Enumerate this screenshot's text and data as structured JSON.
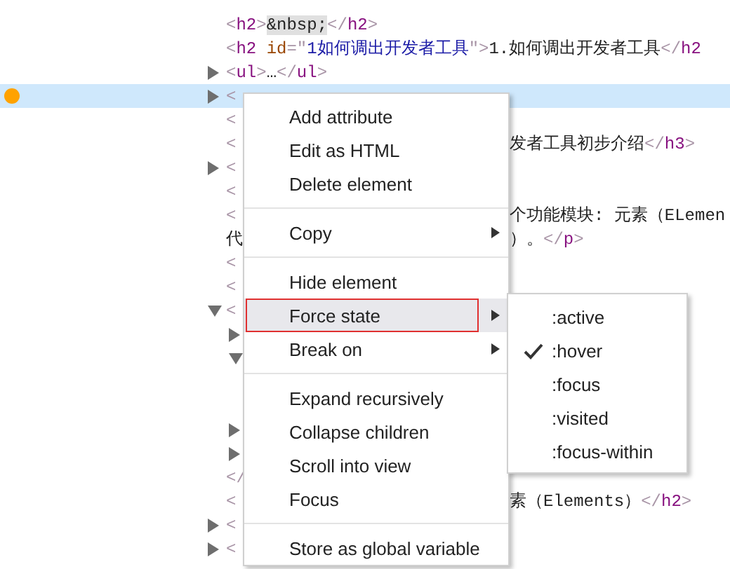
{
  "tree": {
    "rows": [
      {
        "parts": [
          {
            "kind": "tag",
            "text": "<h2>"
          },
          {
            "kind": "entity",
            "text": "&nbsp;"
          },
          {
            "kind": "tag",
            "text": "</h2>"
          }
        ]
      },
      {
        "parts": [
          {
            "kind": "tag",
            "text": "<h2 "
          },
          {
            "kind": "attr",
            "text": "id"
          },
          {
            "kind": "tag",
            "text": "=\""
          },
          {
            "kind": "value",
            "text": "1如何调出开发者工具"
          },
          {
            "kind": "tag",
            "text": "\">"
          },
          {
            "kind": "text",
            "text": "1.如何调出开发者工具"
          },
          {
            "kind": "tag",
            "text": "</h2"
          }
        ]
      },
      {
        "expanded": false,
        "parts": [
          {
            "kind": "tag",
            "text": "<ul>"
          },
          {
            "kind": "text",
            "text": "…"
          },
          {
            "kind": "tag",
            "text": "</ul>"
          }
        ]
      },
      {
        "expanded": false,
        "selected": true,
        "breakpoint": true,
        "parts": [
          {
            "kind": "tag",
            "text": "<"
          }
        ]
      },
      {
        "parts": [
          {
            "kind": "tag",
            "text": "<"
          }
        ]
      },
      {
        "parts": [
          {
            "kind": "tag",
            "text": "<"
          }
        ],
        "right": [
          {
            "kind": "text",
            "text": "发者工具初步介绍"
          },
          {
            "kind": "tag",
            "text": "</h3>"
          }
        ]
      },
      {
        "expanded": false,
        "parts": [
          {
            "kind": "tag",
            "text": "<"
          }
        ]
      },
      {
        "parts": [
          {
            "kind": "tag",
            "text": "<"
          }
        ]
      },
      {
        "parts": [
          {
            "kind": "tag",
            "text": "<"
          }
        ],
        "right": [
          {
            "kind": "text",
            "text": "个功能模块: 元素（ELemen"
          }
        ]
      },
      {
        "parts": [
          {
            "kind": "text",
            "text": "代"
          }
        ],
        "right": [
          {
            "kind": "text",
            "text": "）。"
          },
          {
            "kind": "tag",
            "text": "</p>"
          }
        ]
      },
      {
        "parts": [
          {
            "kind": "tag",
            "text": "<"
          }
        ]
      },
      {
        "parts": [
          {
            "kind": "tag",
            "text": "<"
          }
        ]
      },
      {
        "expanded": true,
        "parts": [
          {
            "kind": "tag",
            "text": "<"
          }
        ],
        "children": [
          {
            "expanded": false
          },
          {
            "expanded": true
          },
          {
            "expanded": false
          },
          {
            "expanded": false
          }
        ]
      },
      {
        "parts": [
          {
            "kind": "tag",
            "text": "</"
          }
        ]
      },
      {
        "parts": [
          {
            "kind": "tag",
            "text": "<"
          }
        ],
        "right": [
          {
            "kind": "text",
            "text": "素（Elements）"
          },
          {
            "kind": "tag",
            "text": "</h2>"
          }
        ]
      },
      {
        "expanded": false,
        "parts": [
          {
            "kind": "tag",
            "text": "<"
          }
        ]
      },
      {
        "expanded": false,
        "parts": [
          {
            "kind": "tag",
            "text": "<"
          }
        ]
      }
    ]
  },
  "context_menu": {
    "groups": [
      [
        {
          "label": "Add attribute",
          "submenu": false,
          "highlighted": false,
          "annotated": false
        },
        {
          "label": "Edit as HTML",
          "submenu": false,
          "highlighted": false,
          "annotated": false
        },
        {
          "label": "Delete element",
          "submenu": false,
          "highlighted": false,
          "annotated": false
        }
      ],
      [
        {
          "label": "Copy",
          "submenu": true,
          "highlighted": false,
          "annotated": false
        }
      ],
      [
        {
          "label": "Hide element",
          "submenu": false,
          "highlighted": false,
          "annotated": false
        },
        {
          "label": "Force state",
          "submenu": true,
          "highlighted": true,
          "annotated": true
        },
        {
          "label": "Break on",
          "submenu": true,
          "highlighted": false,
          "annotated": false
        }
      ],
      [
        {
          "label": "Expand recursively",
          "submenu": false,
          "highlighted": false,
          "annotated": false
        },
        {
          "label": "Collapse children",
          "submenu": false,
          "highlighted": false,
          "annotated": false
        },
        {
          "label": "Scroll into view",
          "submenu": false,
          "highlighted": false,
          "annotated": false
        },
        {
          "label": "Focus",
          "submenu": false,
          "highlighted": false,
          "annotated": false
        }
      ],
      [
        {
          "label": "Store as global variable",
          "submenu": false,
          "highlighted": false,
          "annotated": false
        }
      ]
    ]
  },
  "submenu": {
    "items": [
      {
        "label": ":active",
        "checked": false
      },
      {
        "label": ":hover",
        "checked": true
      },
      {
        "label": ":focus",
        "checked": false
      },
      {
        "label": ":visited",
        "checked": false
      },
      {
        "label": ":focus-within",
        "checked": false
      }
    ]
  }
}
